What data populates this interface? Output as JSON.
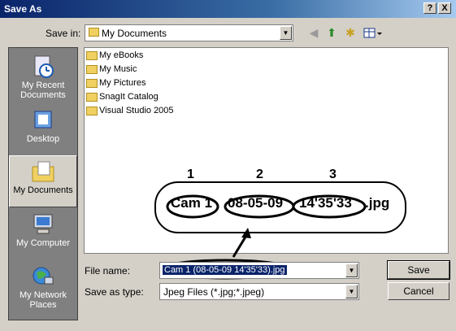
{
  "window": {
    "title": "Save As",
    "help": "?",
    "close": "X"
  },
  "save_in": {
    "label": "Save in:",
    "value": "My Documents"
  },
  "places": [
    {
      "label": "My Recent Documents"
    },
    {
      "label": "Desktop"
    },
    {
      "label": "My Documents"
    },
    {
      "label": "My Computer"
    },
    {
      "label": "My Network Places"
    }
  ],
  "files": [
    {
      "name": "My eBooks"
    },
    {
      "name": "My Music"
    },
    {
      "name": "My Pictures"
    },
    {
      "name": "SnagIt Catalog"
    },
    {
      "name": "Visual Studio 2005"
    }
  ],
  "annotation": {
    "numbers": [
      "1",
      "2",
      "3"
    ],
    "parts": [
      "Cam 1",
      "08-05-09",
      "14'35'33",
      ".jpg"
    ]
  },
  "file_name": {
    "label": "File name:",
    "value": "Cam 1 (08-05-09 14'35'33).jpg"
  },
  "save_as_type": {
    "label": "Save as type:",
    "value": "Jpeg Files (*.jpg;*.jpeg)"
  },
  "buttons": {
    "save": "Save",
    "cancel": "Cancel"
  },
  "colors": {
    "title_start": "#0a246a",
    "face": "#d4d0c8",
    "places_bg": "#808080"
  }
}
